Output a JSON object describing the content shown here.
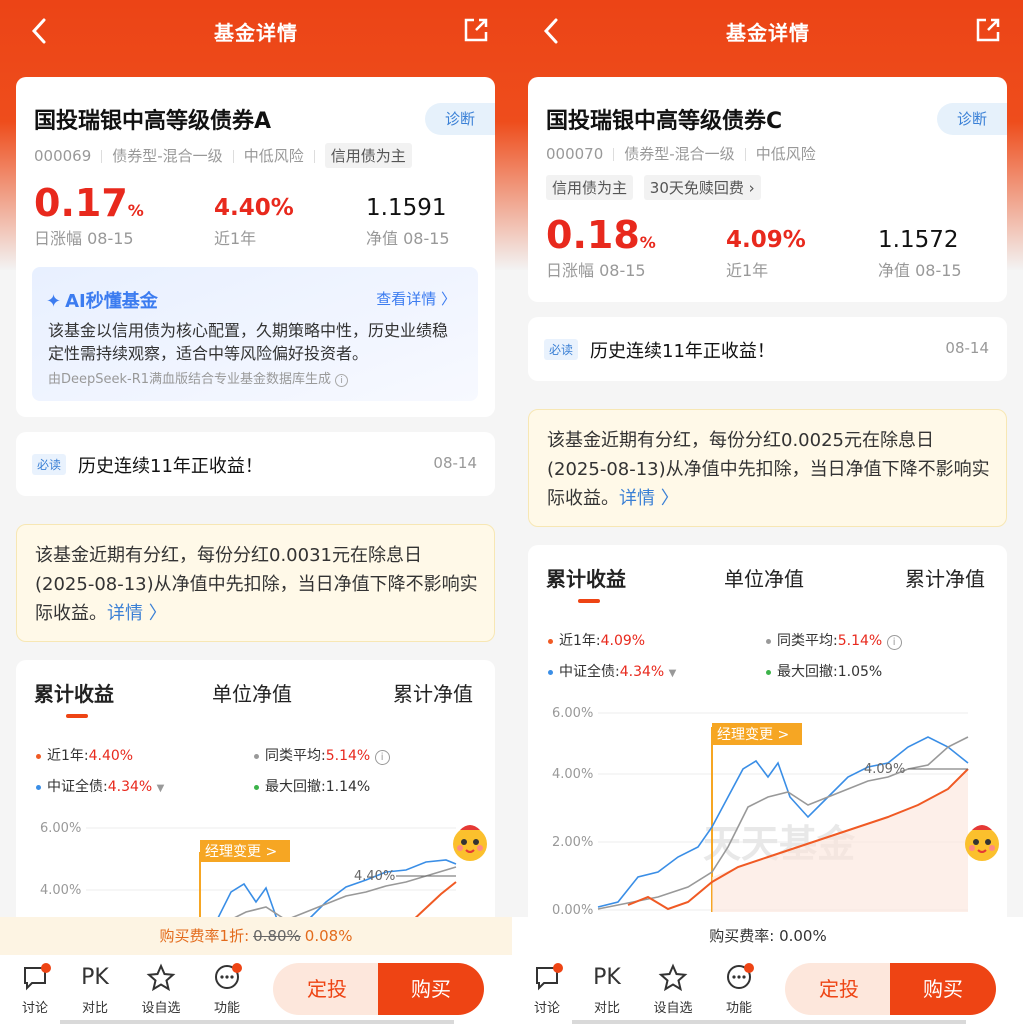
{
  "header": {
    "title": "基金详情"
  },
  "left": {
    "fund_name": "国投瑞银中高等级债券A",
    "diagnose": "诊断",
    "code": "000069",
    "type": "债券型-混合一级",
    "risk": "中低风险",
    "tag": "信用债为主",
    "day_change": "0.17",
    "pct": "%",
    "day_label": "日涨幅 08-15",
    "year_return": "4.40%",
    "year_label": "近1年",
    "nav": "1.1591",
    "nav_label": "净值 08-15",
    "ai_title": "AI秒懂基金",
    "ai_more": "查看详情 〉",
    "ai_text": "该基金以信用债为核心配置，久期策略中性，历史业绩稳定性需持续观察，适合中等风险偏好投资者。",
    "ai_source": "由DeepSeek-R1满血版结合专业基金数据库生成",
    "must_read": "必读",
    "note": "历史连续11年正收益！",
    "note_date": "08-14",
    "dividend": "该基金近期有分红，每份分红0.0031元在除息日(2025-08-13)从净值中先扣除，当日净值下降不影响实际收益。",
    "dividend_link": "详情 〉",
    "tabs": [
      "累计收益",
      "单位净值",
      "累计净值"
    ],
    "legend": {
      "l1": "近1年:",
      "v1": "4.40%",
      "l2": "同类平均:",
      "v2": "5.14%",
      "l3": "中证全债:",
      "v3": "4.34%",
      "l4": "最大回撤:",
      "v4": "1.14%"
    },
    "fee_label": "购买费率1折:",
    "fee_old": "0.80%",
    "fee_new": "0.08%"
  },
  "right": {
    "fund_name": "国投瑞银中高等级债券C",
    "diagnose": "诊断",
    "code": "000070",
    "type": "债券型-混合一级",
    "risk": "中低风险",
    "tag1": "信用债为主",
    "tag2": "30天免赎回费 ›",
    "day_change": "0.18",
    "pct": "%",
    "day_label": "日涨幅 08-15",
    "year_return": "4.09%",
    "year_label": "近1年",
    "nav": "1.1572",
    "nav_label": "净值 08-15",
    "must_read": "必读",
    "note": "历史连续11年正收益！",
    "note_date": "08-14",
    "dividend": "该基金近期有分红，每份分红0.0025元在除息日(2025-08-13)从净值中先扣除，当日净值下降不影响实际收益。",
    "dividend_link": "详情 〉",
    "tabs": [
      "累计收益",
      "单位净值",
      "累计净值"
    ],
    "legend": {
      "l1": "近1年:",
      "v1": "4.09%",
      "l2": "同类平均:",
      "v2": "5.14%",
      "l3": "中证全债:",
      "v3": "4.34%",
      "l4": "最大回撤:",
      "v4": "1.05%"
    },
    "fee": "购买费率: 0.00%"
  },
  "chart_left": {
    "yticks": [
      "6.00%",
      "4.00%"
    ],
    "manager_change": "经理变更 >",
    "end_label": "4.40%"
  },
  "chart_right": {
    "yticks": [
      "6.00%",
      "4.00%",
      "2.00%",
      "0.00%"
    ],
    "manager_change": "经理变更 >",
    "end_label": "4.09%",
    "watermark": "天天基金"
  },
  "nav": {
    "discuss": "讨论",
    "pk": "PK",
    "compare": "对比",
    "watch": "设自选",
    "func": "功能",
    "dingtou": "定投",
    "buy": "购买"
  },
  "colors": {
    "accent": "#ee4414",
    "red": "#e8291d",
    "blue": "#3b80d5",
    "series_fund": "#f05a24",
    "series_avg": "#999999",
    "series_index": "#3a8ee6"
  }
}
